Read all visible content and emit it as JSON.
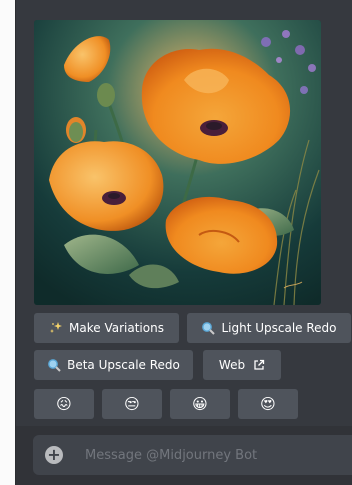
{
  "message": {
    "image_alt": "Orange poppies painting"
  },
  "buttons": {
    "make_variations": "Make Variations",
    "light_upscale_redo": "Light Upscale Redo",
    "beta_upscale_redo": "Beta Upscale Redo",
    "web": "Web"
  },
  "reactions": [
    {
      "icon": "confounded-face-icon",
      "glyph": "😖"
    },
    {
      "icon": "unamused-face-icon",
      "glyph": "😒"
    },
    {
      "icon": "grinning-face-icon",
      "glyph": "😀"
    },
    {
      "icon": "heart-eyes-face-icon",
      "glyph": "😍"
    }
  ],
  "composer": {
    "placeholder": "Message @Midjourney Bot"
  },
  "colors": {
    "background": "#36393f",
    "button": "#4f545c",
    "input": "#40444b"
  }
}
